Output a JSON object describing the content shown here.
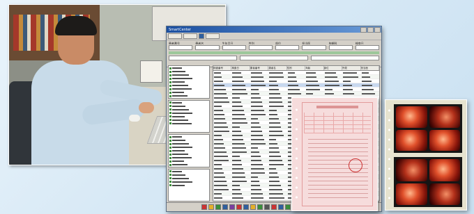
{
  "app_window": {
    "title": "SmartCenter",
    "filter_labels": [
      "患者番号",
      "患者名",
      "生年月日",
      "性別",
      "部位",
      "担当医",
      "依頼科",
      "検査日"
    ],
    "table_headers": [
      "検査番号",
      "検査日",
      "患者番号",
      "患者名",
      "性別",
      "年齢",
      "部位",
      "所見",
      "担当医"
    ],
    "row_count": 32,
    "selected_row": 3
  },
  "form_sheet": {
    "title": "内視鏡検査依頼書"
  },
  "image_sheet": {
    "image_count": 8
  },
  "colors": {
    "background": "#d6e8f5",
    "window_title": "#1b4fa0",
    "form_pink": "#f6dcdc",
    "endoscopy_red": "#e0502b"
  }
}
